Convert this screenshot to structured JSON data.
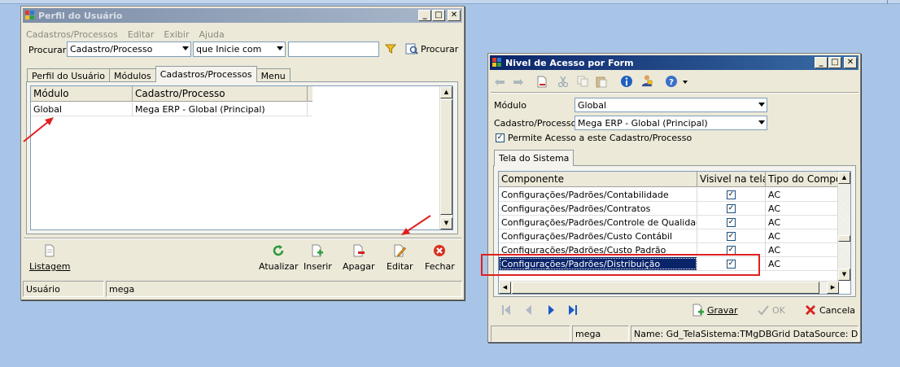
{
  "left_window": {
    "title": "Perfil do Usuário",
    "menu": [
      "Cadastros/Processos",
      "Editar",
      "Exibir",
      "Ajuda"
    ],
    "search_label": "Procurar",
    "search_field": "Cadastro/Processo",
    "search_mode": "que Inicie com",
    "search_value": "",
    "search_button": "Procurar",
    "tabs": [
      "Perfil do Usuário",
      "Módulos",
      "Cadastros/Processos",
      "Menu"
    ],
    "active_tab": "Cadastros/Processos",
    "grid": {
      "columns": [
        "Módulo",
        "Cadastro/Processo"
      ],
      "rows": [
        [
          "Global",
          "Mega ERP - Global (Principal)"
        ]
      ]
    },
    "toolbar": {
      "listagem": "Listagem",
      "atualizar": "Atualizar",
      "inserir": "Inserir",
      "apagar": "Apagar",
      "editar": "Editar",
      "fechar": "Fechar"
    },
    "status": [
      "Usuário",
      "mega"
    ]
  },
  "right_window": {
    "title": "Nivel de Acesso por Form",
    "modulo_label": "Módulo",
    "modulo_value": "Global",
    "cadastro_label": "Cadastro/Processo",
    "cadastro_value": "Mega ERP - Global (Principal)",
    "permite_label": "Permite Acesso a este Cadastro/Processo",
    "permite_checked": true,
    "tab": "Tela do Sistema",
    "grid": {
      "columns": [
        "Componente",
        "Visivel na tela",
        "Tipo do Compo"
      ],
      "rows": [
        {
          "componente": "Configurações/Padrões/Contabilidade",
          "visivel": true,
          "tipo": "AC"
        },
        {
          "componente": "Configurações/Padrões/Contratos",
          "visivel": true,
          "tipo": "AC"
        },
        {
          "componente": "Configurações/Padrões/Controle de Qualidade",
          "visivel": true,
          "tipo": "AC"
        },
        {
          "componente": "Configurações/Padrões/Custo Contábil",
          "visivel": true,
          "tipo": "AC"
        },
        {
          "componente": "Configurações/Padrões/Custo Padrão",
          "visivel": true,
          "tipo": "AC"
        },
        {
          "componente": "Configurações/Padrões/Distribuição",
          "visivel": true,
          "tipo": "AC"
        }
      ],
      "selected_row": 5
    },
    "buttons": {
      "gravar": "Gravar",
      "ok": "OK",
      "cancela": "Cancela"
    },
    "status": [
      "",
      "mega",
      "Name: Gd_TelaSistema:TMgDBGrid DataSource: Ds_Co"
    ]
  },
  "colors": {
    "desktop": "#a8c4e6",
    "annotation": "#e02020",
    "selection": "#0a246a"
  }
}
